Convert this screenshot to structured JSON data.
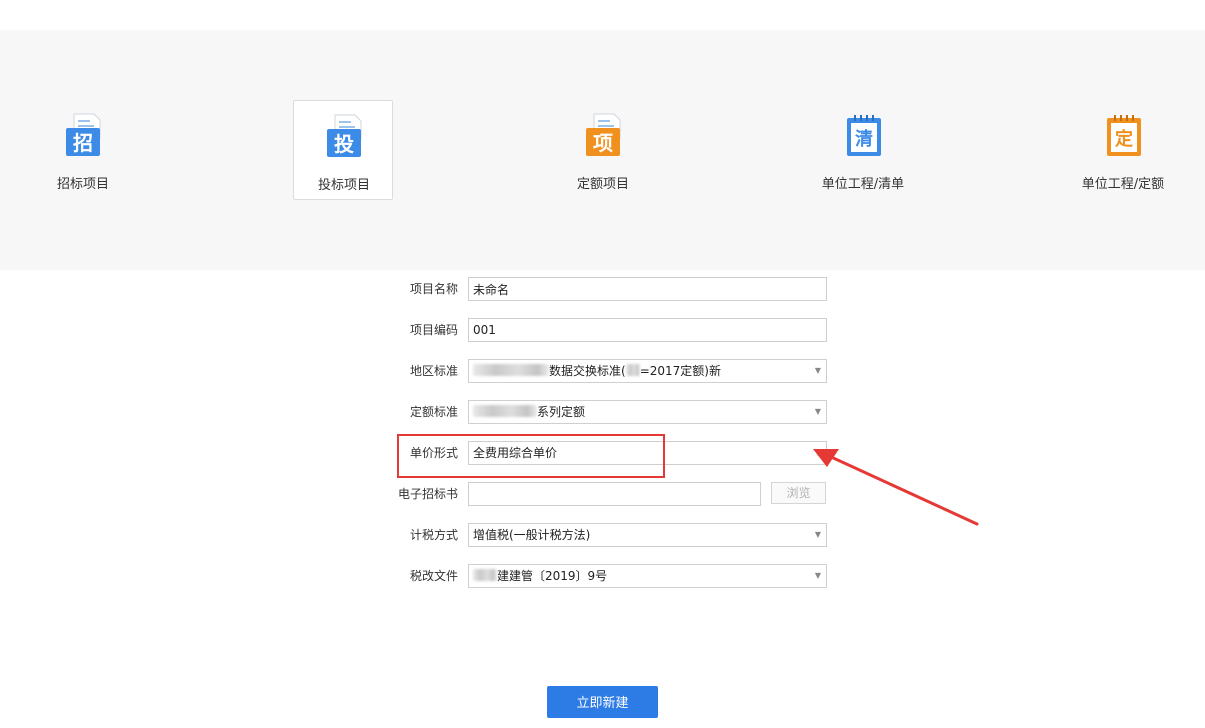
{
  "project_types": [
    {
      "id": "tender",
      "label": "招标项目",
      "icon_char": "招",
      "icon_color": "#3c8ce7",
      "icon_style": "doc"
    },
    {
      "id": "bid",
      "label": "投标项目",
      "icon_char": "投",
      "icon_color": "#3c8ce7",
      "icon_style": "doc"
    },
    {
      "id": "quota",
      "label": "定额项目",
      "icon_char": "项",
      "icon_color": "#f0901e",
      "icon_style": "doc"
    },
    {
      "id": "unit-list",
      "label": "单位工程/清单",
      "icon_char": "清",
      "icon_color": "#3c8ce7",
      "icon_style": "notebook"
    },
    {
      "id": "unit-quota",
      "label": "单位工程/定额",
      "icon_char": "定",
      "icon_color": "#f0901e",
      "icon_style": "notebook"
    }
  ],
  "selected_type": "bid",
  "form": {
    "project_name": {
      "label": "项目名称",
      "value": "未命名"
    },
    "project_code": {
      "label": "项目编码",
      "value": "001"
    },
    "region_standard": {
      "label": "地区标准",
      "value_part1": "数据交换标准(",
      "value_part2": "=2017定额)新"
    },
    "quota_standard": {
      "label": "定额标准",
      "value": "系列定额"
    },
    "unit_price_form": {
      "label": "单价形式",
      "value": "全费用综合单价"
    },
    "e_tender_doc": {
      "label": "电子招标书",
      "value": "",
      "browse_label": "浏览"
    },
    "tax_method": {
      "label": "计税方式",
      "value": "增值税(一般计税方法)"
    },
    "tax_reform_doc": {
      "label": "税改文件",
      "value": "建建管〔2019〕9号"
    }
  },
  "create_button_label": "立即新建",
  "annotation_color": "#e53935",
  "accent_color": "#2d7be5"
}
